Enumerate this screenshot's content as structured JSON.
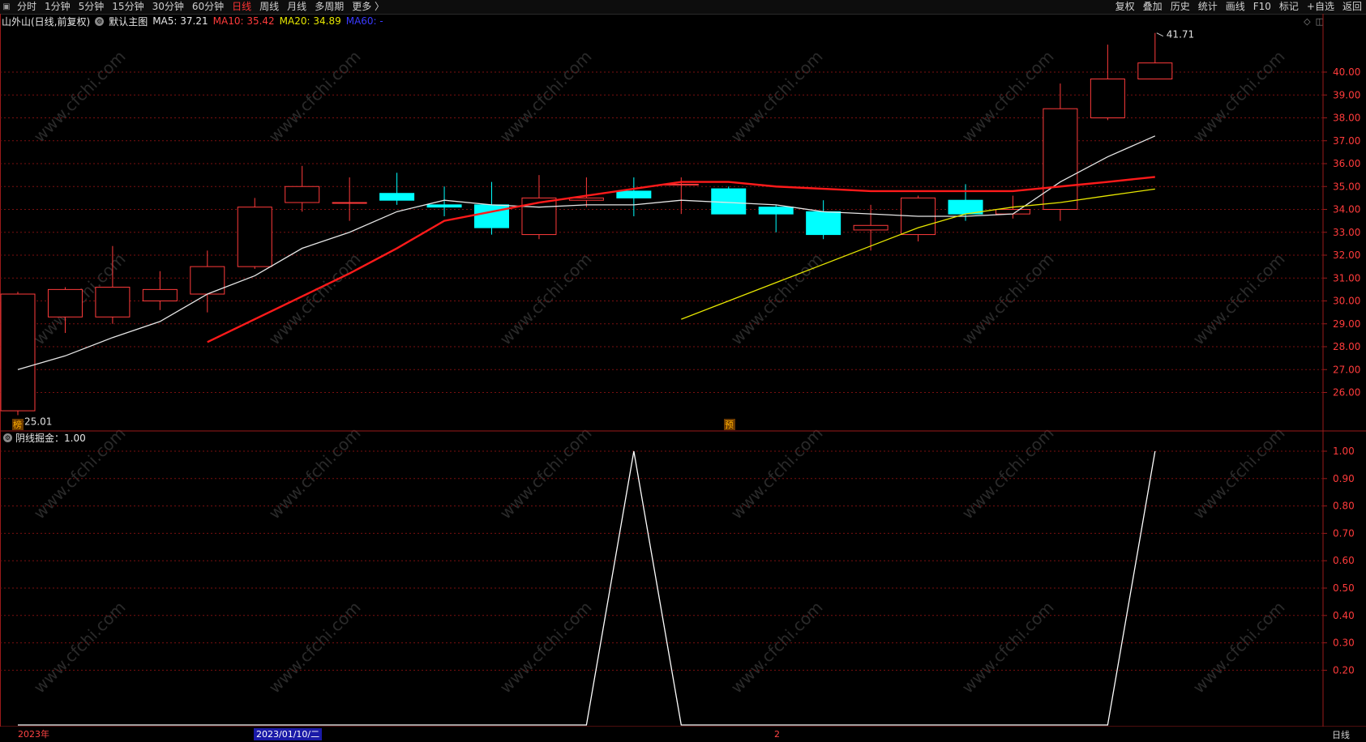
{
  "toolbar": {
    "periods": [
      {
        "label": "分时",
        "active": false
      },
      {
        "label": "1分钟",
        "active": false
      },
      {
        "label": "5分钟",
        "active": false
      },
      {
        "label": "15分钟",
        "active": false
      },
      {
        "label": "30分钟",
        "active": false
      },
      {
        "label": "60分钟",
        "active": false
      },
      {
        "label": "日线",
        "active": true
      },
      {
        "label": "周线",
        "active": false
      },
      {
        "label": "月线",
        "active": false
      },
      {
        "label": "多周期",
        "active": false
      },
      {
        "label": "更多 〉",
        "active": false
      }
    ],
    "right_items": [
      "复权",
      "叠加",
      "历史",
      "统计",
      "画线",
      "F10",
      "标记",
      "+自选",
      "返回"
    ]
  },
  "header": {
    "title": "山外山(日线,前复权)",
    "main_label": "默认主图",
    "ma5": "MA5: 37.21",
    "ma10": "MA10: 35.42",
    "ma20": "MA20: 34.89",
    "ma60": "MA60: -"
  },
  "indicator": {
    "label": "阴线掘金：1.00"
  },
  "annotations": {
    "high_label": "41.71",
    "low_label": "←25.01",
    "badge1": "榜",
    "badge2": "预"
  },
  "watermark": "www.cfchi.com",
  "colors": {
    "up": "#ff3b3b",
    "down": "#00ffff",
    "ma5": "#e6e6e6",
    "ma10": "#ff1a1a",
    "ma20": "#e6e600",
    "grid": "#7a1010",
    "axis_text": "#ff3b3b"
  },
  "timescale": {
    "year": "2023年",
    "selected": "2023/01/10/二",
    "mid": "2",
    "period": "日线"
  },
  "chart_data": [
    {
      "type": "candlestick",
      "title": "山外山(日线,前复权)",
      "ylim": [
        25.01,
        41.71
      ],
      "yticks": [
        "40.00",
        "39.00",
        "38.00",
        "37.00",
        "36.00",
        "35.00",
        "34.00",
        "33.00",
        "32.00",
        "31.00",
        "30.00",
        "29.00",
        "28.00",
        "27.00",
        "26.00"
      ],
      "candles": [
        {
          "o": 25.2,
          "h": 30.4,
          "l": 25.01,
          "c": 30.3
        },
        {
          "o": 29.3,
          "h": 30.6,
          "l": 28.6,
          "c": 30.5
        },
        {
          "o": 29.3,
          "h": 32.4,
          "l": 29.0,
          "c": 30.6
        },
        {
          "o": 30.0,
          "h": 31.3,
          "l": 29.6,
          "c": 30.5
        },
        {
          "o": 30.3,
          "h": 32.2,
          "l": 29.5,
          "c": 31.5
        },
        {
          "o": 31.5,
          "h": 34.5,
          "l": 31.4,
          "c": 34.1
        },
        {
          "o": 34.3,
          "h": 35.9,
          "l": 33.9,
          "c": 35.0
        },
        {
          "o": 34.3,
          "h": 35.4,
          "l": 33.5,
          "c": 34.3
        },
        {
          "o": 34.7,
          "h": 35.6,
          "l": 34.2,
          "c": 34.4
        },
        {
          "o": 34.2,
          "h": 35.0,
          "l": 33.7,
          "c": 34.1
        },
        {
          "o": 34.2,
          "h": 35.2,
          "l": 32.9,
          "c": 33.2
        },
        {
          "o": 32.9,
          "h": 35.5,
          "l": 32.7,
          "c": 34.5
        },
        {
          "o": 34.4,
          "h": 35.4,
          "l": 34.1,
          "c": 34.5
        },
        {
          "o": 34.8,
          "h": 35.4,
          "l": 33.7,
          "c": 34.5
        },
        {
          "o": 35.1,
          "h": 35.4,
          "l": 33.8,
          "c": 35.1
        },
        {
          "o": 34.9,
          "h": 35.0,
          "l": 33.8,
          "c": 33.8
        },
        {
          "o": 34.1,
          "h": 34.2,
          "l": 33.0,
          "c": 33.8
        },
        {
          "o": 33.9,
          "h": 34.4,
          "l": 32.7,
          "c": 32.9
        },
        {
          "o": 33.1,
          "h": 34.2,
          "l": 32.2,
          "c": 33.3
        },
        {
          "o": 32.9,
          "h": 34.6,
          "l": 32.6,
          "c": 34.5
        },
        {
          "o": 34.4,
          "h": 35.1,
          "l": 33.5,
          "c": 33.8
        },
        {
          "o": 33.8,
          "h": 34.6,
          "l": 33.6,
          "c": 34.0
        },
        {
          "o": 34.0,
          "h": 39.5,
          "l": 33.5,
          "c": 38.4
        },
        {
          "o": 38.0,
          "h": 41.2,
          "l": 37.9,
          "c": 39.7
        },
        {
          "o": 39.7,
          "h": 41.71,
          "l": 39.7,
          "c": 40.4
        }
      ],
      "series": [
        {
          "name": "MA5",
          "values": [
            27.0,
            27.6,
            28.4,
            29.1,
            30.3,
            31.1,
            32.3,
            33.0,
            33.9,
            34.4,
            34.2,
            34.1,
            34.2,
            34.2,
            34.4,
            34.3,
            34.2,
            33.9,
            33.8,
            33.7,
            33.7,
            33.8,
            35.2,
            36.3,
            37.21
          ]
        },
        {
          "name": "MA10",
          "values": [
            null,
            null,
            null,
            null,
            28.2,
            29.2,
            30.2,
            31.2,
            32.3,
            33.5,
            33.9,
            34.3,
            34.6,
            34.9,
            35.2,
            35.2,
            35.0,
            34.9,
            34.8,
            34.8,
            34.8,
            34.8,
            35.0,
            35.2,
            35.42
          ]
        },
        {
          "name": "MA20",
          "values": [
            null,
            null,
            null,
            null,
            null,
            null,
            null,
            null,
            null,
            null,
            null,
            null,
            null,
            null,
            29.2,
            30.0,
            30.8,
            31.6,
            32.4,
            33.2,
            33.8,
            34.1,
            34.3,
            34.6,
            34.89
          ]
        }
      ]
    },
    {
      "type": "line",
      "title": "阴线掘金",
      "ylim": [
        0,
        1.0
      ],
      "yticks": [
        "1.00",
        "0.90",
        "0.80",
        "0.70",
        "0.60",
        "0.50",
        "0.40",
        "0.30",
        "0.20"
      ],
      "series": [
        {
          "name": "阴线掘金",
          "values": [
            0,
            0,
            0,
            0,
            0,
            0,
            0,
            0,
            0,
            0,
            0,
            0,
            0,
            1,
            0,
            0,
            0,
            0,
            0,
            0,
            0,
            0,
            0,
            0,
            1
          ]
        }
      ]
    }
  ]
}
